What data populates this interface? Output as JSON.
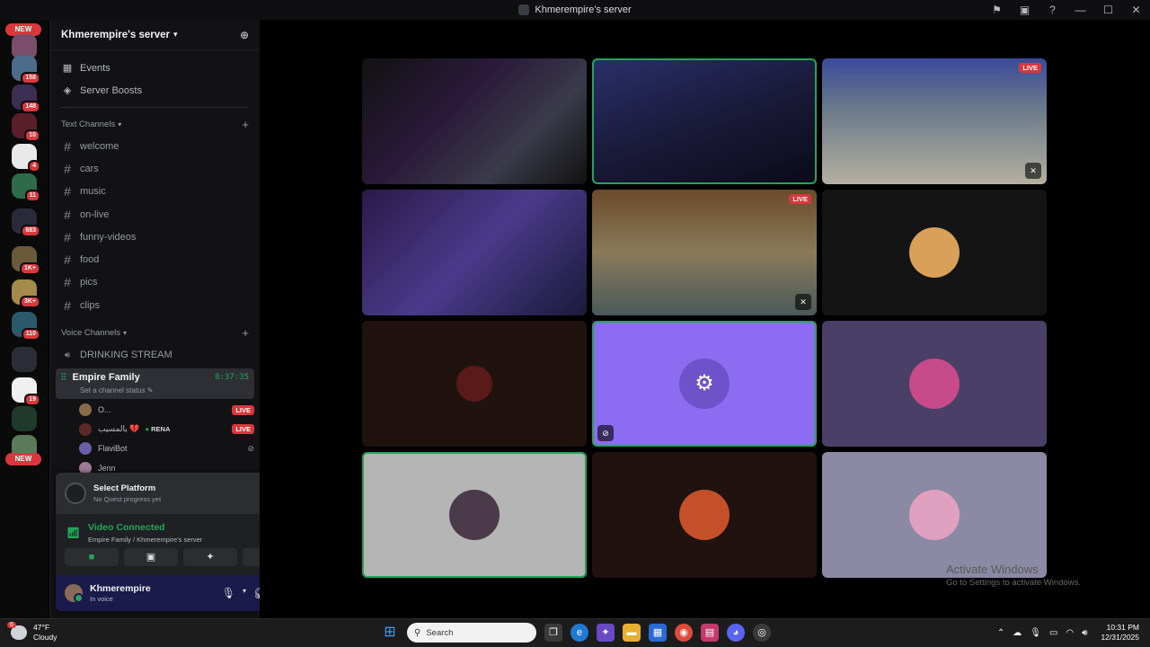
{
  "window": {
    "title": "Khmerempire's server",
    "controls": [
      "⚑",
      "▣",
      "?",
      "—",
      "☐",
      "✕"
    ]
  },
  "guilds": {
    "new_top": "NEW",
    "new_bottom": "NEW",
    "badges": [
      "158",
      "148",
      "10",
      "4",
      "11",
      "683",
      "1K+",
      "3K+",
      "110",
      "19"
    ]
  },
  "sidebar": {
    "server_name": "Khmerempire's server",
    "nav": [
      {
        "label": "Events",
        "icon": "calendar-icon"
      },
      {
        "label": "Server Boosts",
        "icon": "boost-icon"
      }
    ],
    "text_category": "Text Channels",
    "text_channels": [
      "welcome",
      "cars",
      "music",
      "on-live",
      "funny-videos",
      "food",
      "pics",
      "clips"
    ],
    "voice_category": "Voice Channels",
    "voice_channels": [
      "DRINKING STREAM"
    ],
    "active_voice": {
      "name": "Empire Family",
      "timer": "8:37:35",
      "status": "Set a channel status"
    },
    "members": [
      {
        "name": "O...",
        "live": "LIVE",
        "tag": ""
      },
      {
        "name": "يالمسيب 💔",
        "live": "LIVE",
        "tag": "RENA"
      },
      {
        "name": "FlaviBot",
        "live": "",
        "tag": ""
      },
      {
        "name": "Jenn",
        "live": "",
        "tag": ""
      }
    ]
  },
  "panel": {
    "quest_title": "Select Platform",
    "quest_sub": "No Quest progress yet",
    "rtc_status": "Video Connected",
    "rtc_location": "Empire Family / Khmerempire's server",
    "user_name": "Khmerempire",
    "user_status": "In voice"
  },
  "stage": {
    "tiles": [
      {
        "live": ""
      },
      {
        "live": ""
      },
      {
        "live": "LIVE"
      },
      {
        "live": ""
      },
      {
        "live": "LIVE"
      },
      {
        "live": ""
      },
      {
        "live": ""
      },
      {
        "live": ""
      },
      {
        "live": ""
      },
      {
        "live": ""
      },
      {
        "live": ""
      },
      {
        "live": ""
      }
    ],
    "colors": {
      "purple": "#8c6cf1",
      "slate": "#4a3f66",
      "grey": "#b5b5b5",
      "lavender": "#8b89a3",
      "dark": "#1f120f"
    }
  },
  "watermark": {
    "line1": "Activate Windows",
    "line2": "Go to Settings to activate Windows."
  },
  "taskbar": {
    "weather_badge": "6",
    "temp": "47°F",
    "condition": "Cloudy",
    "search_placeholder": "Search",
    "time": "10:31 PM",
    "date": "12/31/2025"
  }
}
